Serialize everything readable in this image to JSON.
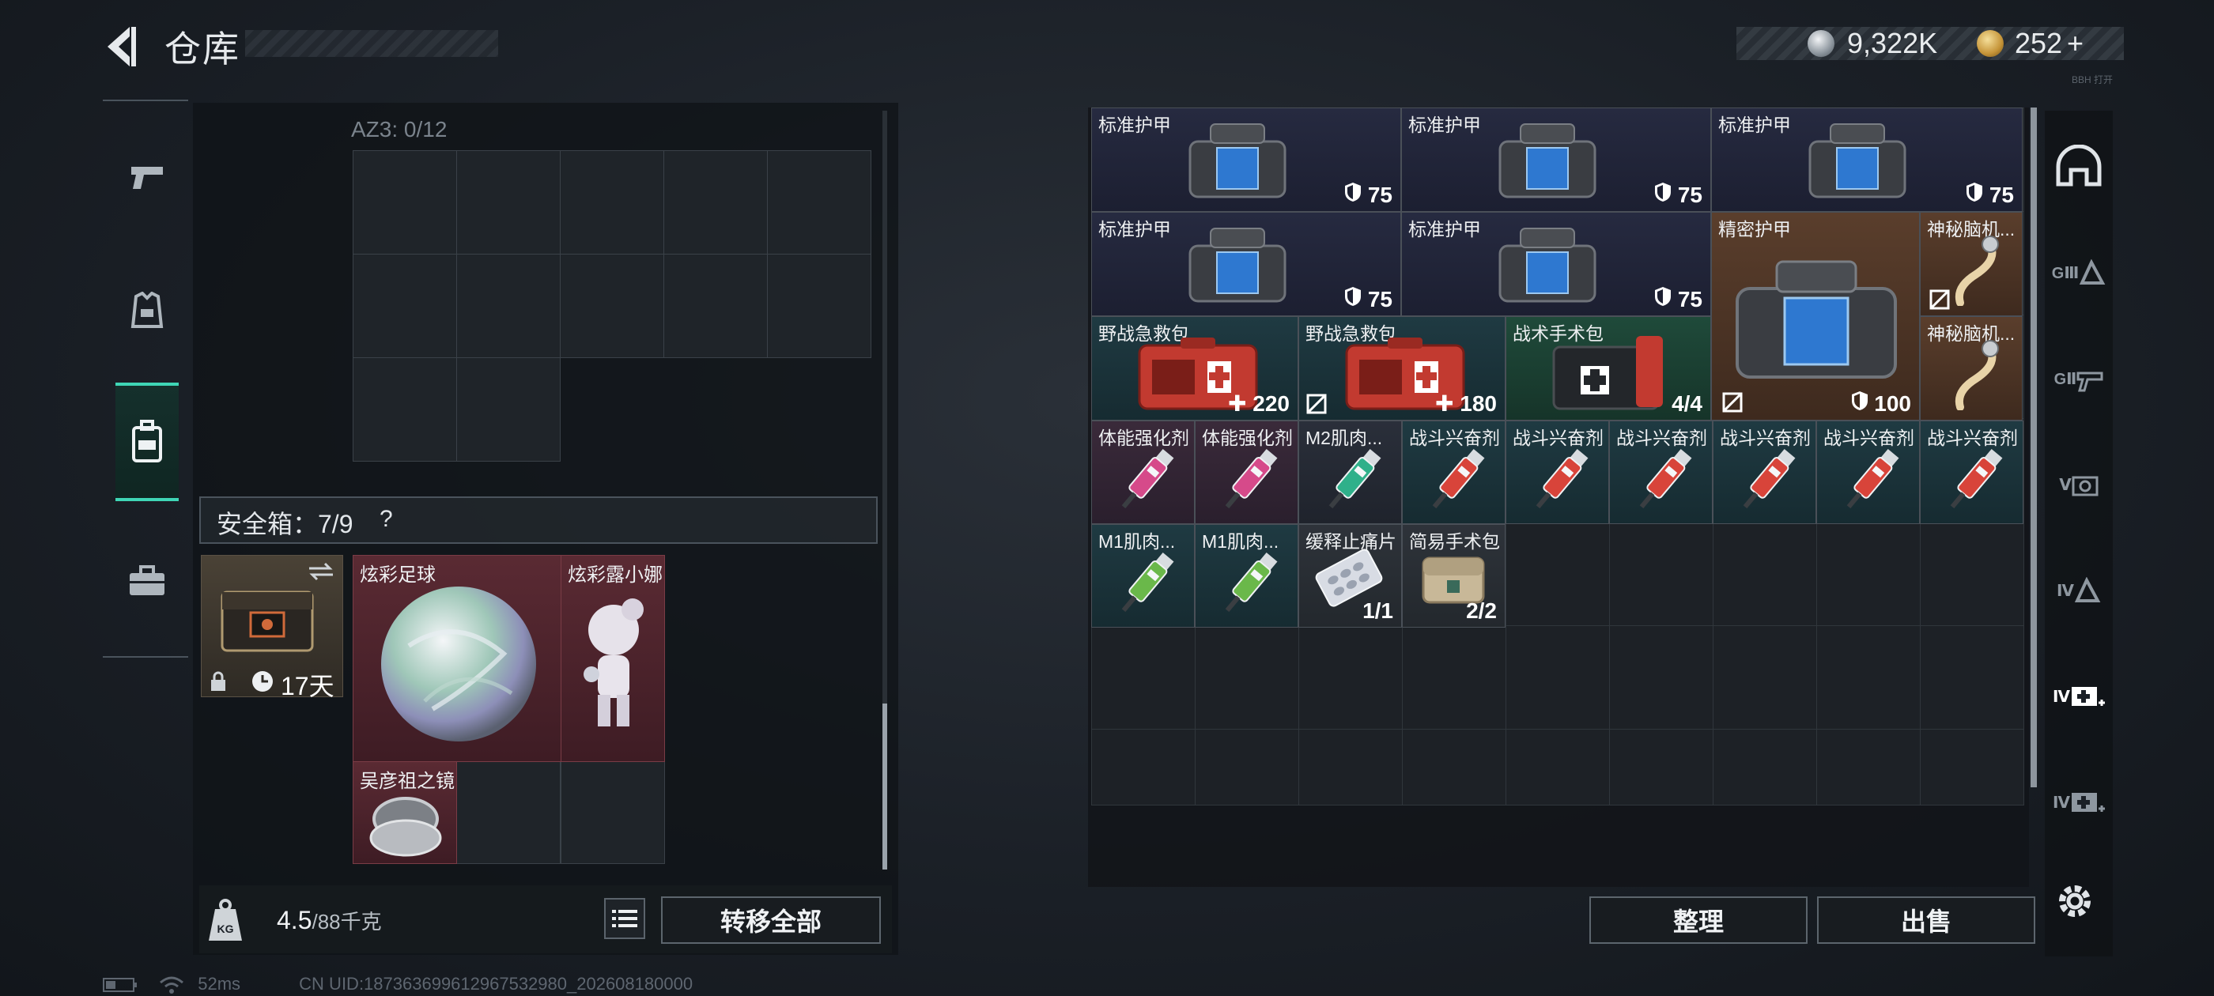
{
  "header": {
    "title": "仓库",
    "silver_amount": "9,322K",
    "gold_amount": "252",
    "gold_plus": "+",
    "tiny_label": "BBH 打开"
  },
  "left_nav": {
    "items": [
      {
        "icon": "pistol-icon"
      },
      {
        "icon": "vest-icon"
      },
      {
        "icon": "backpack-icon",
        "active": true
      },
      {
        "icon": "briefcase-icon"
      }
    ]
  },
  "backpack": {
    "container_label": "AZ3: 0/12",
    "safebox_label": "安全箱：7/9",
    "help": "?",
    "case_timer": "17天",
    "items": [
      {
        "name": "炫彩足球"
      },
      {
        "name": "炫彩露小娜"
      },
      {
        "name": "吴彦祖之镜"
      }
    ],
    "weight_value": "4.5",
    "weight_max": "/88千克",
    "weight_icon_label": "KG",
    "transfer_all": "转移全部"
  },
  "warehouse": {
    "items": [
      {
        "name": "标准护甲",
        "value": "75"
      },
      {
        "name": "标准护甲",
        "value": "75"
      },
      {
        "name": "标准护甲",
        "value": "75"
      },
      {
        "name": "标准护甲",
        "value": "75"
      },
      {
        "name": "标准护甲",
        "value": "75"
      },
      {
        "name": "精密护甲",
        "value": "100"
      },
      {
        "name": "神秘脑机..."
      },
      {
        "name": "神秘脑机..."
      },
      {
        "name": "野战急救包",
        "value": "220"
      },
      {
        "name": "野战急救包",
        "value": "180"
      },
      {
        "name": "战术手术包",
        "value": "4/4"
      },
      {
        "name": "体能强化剂"
      },
      {
        "name": "体能强化剂"
      },
      {
        "name": "M2肌肉..."
      },
      {
        "name": "战斗兴奋剂"
      },
      {
        "name": "战斗兴奋剂"
      },
      {
        "name": "战斗兴奋剂"
      },
      {
        "name": "战斗兴奋剂"
      },
      {
        "name": "战斗兴奋剂"
      },
      {
        "name": "战斗兴奋剂"
      },
      {
        "name": "M1肌肉..."
      },
      {
        "name": "M1肌肉..."
      },
      {
        "name": "缓释止痛片",
        "value": "1/1"
      },
      {
        "name": "简易手术包",
        "value": "2/2"
      }
    ],
    "sort_label": "整理",
    "sell_label": "出售"
  },
  "right_tabs": [
    "GⅢ",
    "GⅡ",
    "Ⅴ",
    "Ⅳ",
    "Ⅳ",
    "Ⅳ"
  ],
  "status": {
    "ping": "52ms",
    "uid": "CN UID:18736369961296753​2980_202608180000"
  },
  "colors": {
    "accent": "#3fd6b6",
    "item_navy": "#262a40",
    "item_brown": "#5a3e2c",
    "item_teal": "#1f3a42",
    "item_red": "#5a2a33"
  }
}
